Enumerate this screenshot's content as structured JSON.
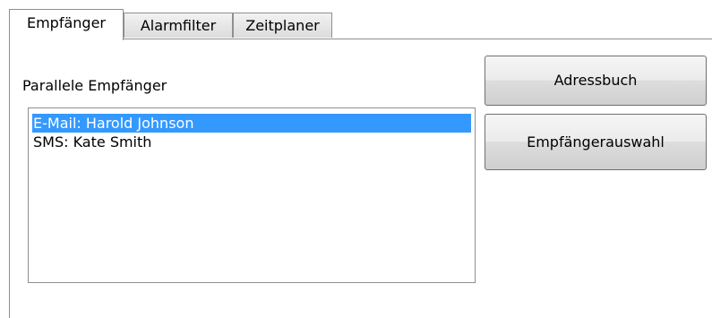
{
  "tabs": [
    {
      "label": "Empfänger",
      "active": true
    },
    {
      "label": "Alarmfilter",
      "active": false
    },
    {
      "label": "Zeitplaner",
      "active": false
    }
  ],
  "recipients": {
    "label": "Parallele Empfänger",
    "items": [
      {
        "text": "E-Mail: Harold Johnson",
        "selected": true
      },
      {
        "text": "SMS: Kate Smith",
        "selected": false
      }
    ]
  },
  "buttons": {
    "address_book": "Adressbuch",
    "recipient_selection": "Empfängerauswahl"
  },
  "colors": {
    "selection": "#3399ff",
    "border": "#8e8f8f"
  }
}
